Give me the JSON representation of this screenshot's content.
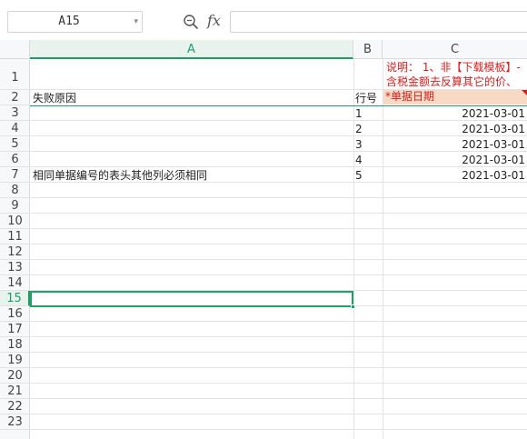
{
  "formula_bar": {
    "cell_ref": "A15",
    "fx": "fx",
    "formula": "",
    "icons": [
      "chevron-down-icon",
      "zoom-icon"
    ]
  },
  "columns": [
    "A",
    "B",
    "C"
  ],
  "active_column": "A",
  "rows": [
    "1",
    "2",
    "3",
    "4",
    "5",
    "6",
    "7",
    "8",
    "9",
    "10",
    "11",
    "12",
    "13",
    "14",
    "15",
    "16",
    "17",
    "18",
    "19",
    "20",
    "21",
    "22",
    "23"
  ],
  "active_row": "15",
  "cells": {
    "C1_line1": "说明： 1、非【下载模板】-",
    "C1_line2": "含税金额去反算其它的价、",
    "A2": "失败原因",
    "B2": "行号",
    "C2": "*单据日期",
    "A7": "相同单据编号的表头其他列必须相同",
    "B3": "1",
    "B4": "2",
    "B5": "3",
    "B6": "4",
    "B7": "5",
    "C3": "2021-03-01",
    "C4": "2021-03-01",
    "C5": "2021-03-01",
    "C6": "2021-03-01",
    "C7": "2021-03-01"
  },
  "colors": {
    "accent": "#1f9d6a",
    "notice_text": "#d21f1f",
    "required_header_fill": "#f8d9c4"
  }
}
